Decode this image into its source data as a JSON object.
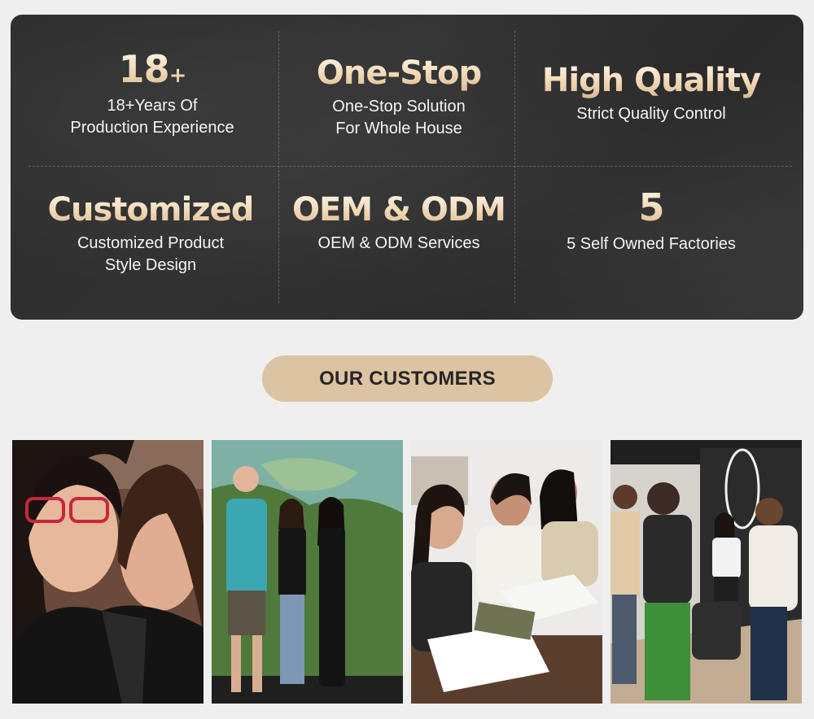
{
  "features": [
    {
      "headline": "18",
      "suffix": "+",
      "lines": [
        "18+Years Of",
        "Production Experience"
      ]
    },
    {
      "headline": "One-Stop",
      "lines": [
        "One-Stop Solution",
        "For Whole House"
      ]
    },
    {
      "headline": "High Quality",
      "lines": [
        "Strict Quality Control"
      ]
    },
    {
      "headline": "Customized",
      "lines": [
        "Customized Product",
        "Style Design"
      ]
    },
    {
      "headline": "OEM & ODM",
      "lines": [
        "OEM & ODM Services"
      ]
    },
    {
      "headline": "5",
      "lines": [
        "5 Self Owned Factories"
      ]
    }
  ],
  "customers": {
    "title": "OUR CUSTOMERS",
    "photos": [
      {
        "icon": "photo-selfie-two-women"
      },
      {
        "icon": "photo-group-map-wall"
      },
      {
        "icon": "photo-signing-documents"
      },
      {
        "icon": "photo-showroom-visit"
      }
    ]
  },
  "colors": {
    "panel": "#2e2e2e",
    "accent": "#dcc3a2",
    "headline": "#f0d7b4"
  }
}
